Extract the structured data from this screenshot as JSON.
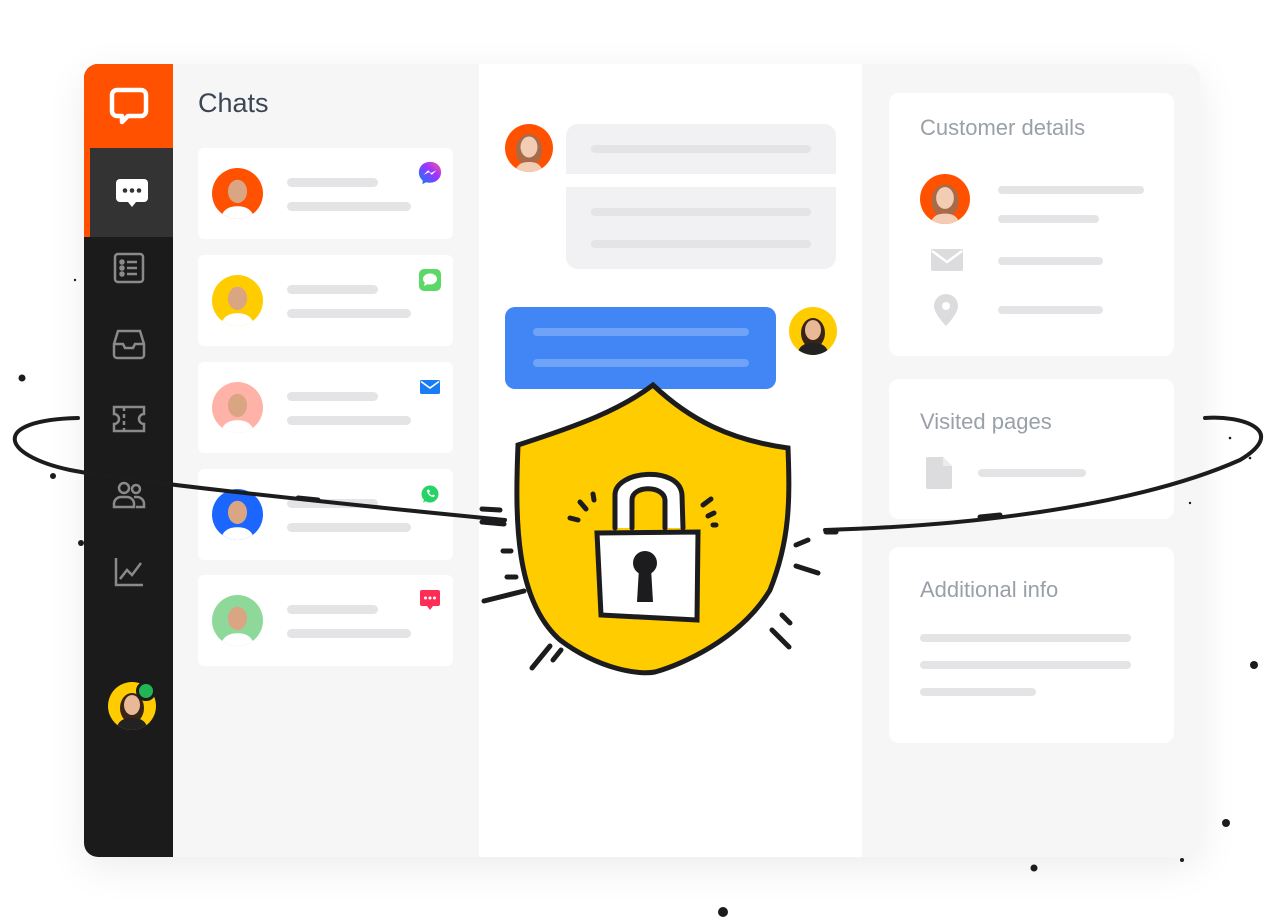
{
  "chats": {
    "title": "Chats",
    "items": [
      {
        "channel": "messenger",
        "avatar_bg": "#ff5100"
      },
      {
        "channel": "imessage",
        "avatar_bg": "#ffcc00"
      },
      {
        "channel": "email",
        "avatar_bg": "#ffb3a8"
      },
      {
        "channel": "whatsapp",
        "avatar_bg": "#1a66ff"
      },
      {
        "channel": "sms",
        "avatar_bg": "#8ed99a"
      }
    ]
  },
  "sidebar": {
    "items": [
      "chats-icon",
      "list-icon",
      "inbox-icon",
      "ticket-icon",
      "people-icon",
      "chart-icon"
    ],
    "status": "online"
  },
  "right": {
    "customer_details": "Customer details",
    "visited_pages": "Visited pages",
    "additional_info": "Additional info"
  },
  "colors": {
    "brand": "#ff5100",
    "blue": "#4285f4",
    "shield": "#ffcc00",
    "sidebar": "#1b1b1b"
  }
}
